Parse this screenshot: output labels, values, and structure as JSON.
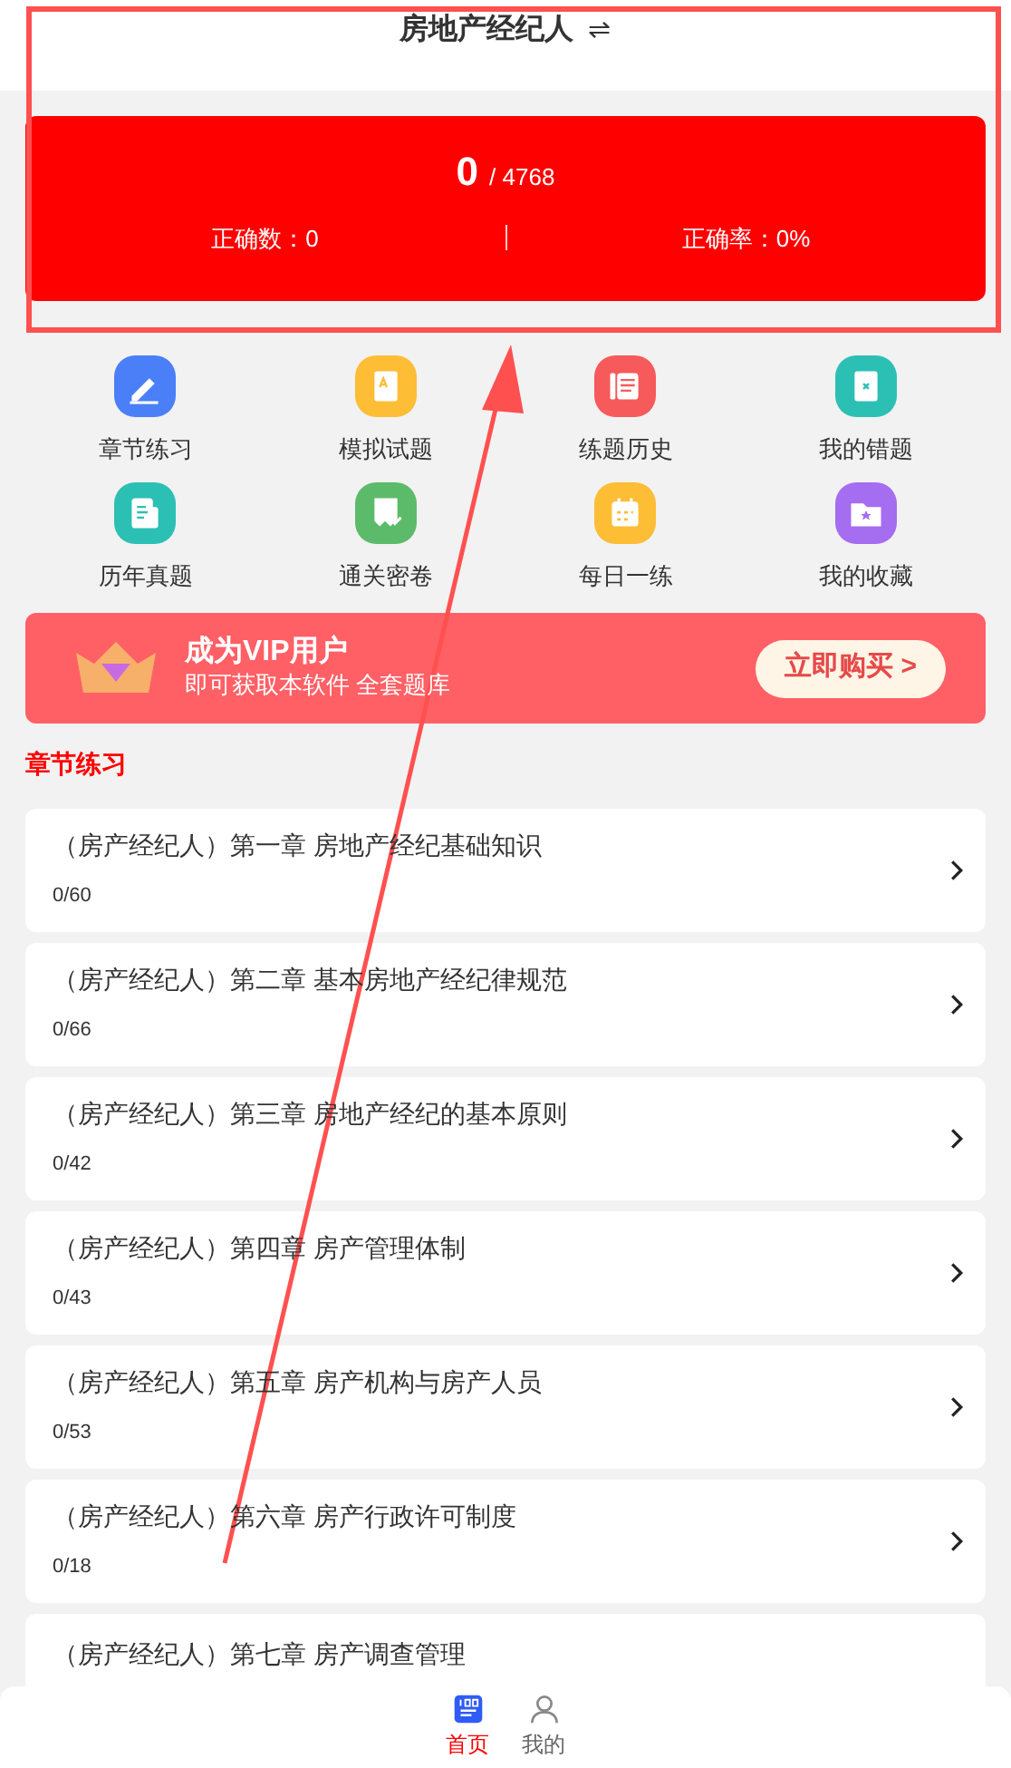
{
  "header": {
    "title": "房地产经纪人",
    "switch_icon": "⇌"
  },
  "summary": {
    "done": "0",
    "total": "/ 4768",
    "correct_count": "正确数：0",
    "correct_rate": "正确率：0%"
  },
  "shortcuts": [
    {
      "label": "章节练习",
      "kind": "pencil",
      "color": "#4a7ff7"
    },
    {
      "label": "模拟试题",
      "kind": "scroll",
      "color": "#fdbd35"
    },
    {
      "label": "练题历史",
      "kind": "notes",
      "color": "#f75a5a"
    },
    {
      "label": "我的错题",
      "kind": "notebook",
      "color": "#2cc0b4"
    },
    {
      "label": "历年真题",
      "kind": "doc",
      "color": "#2cc0b4"
    },
    {
      "label": "通关密卷",
      "kind": "paper",
      "color": "#5cbb6a"
    },
    {
      "label": "每日一练",
      "kind": "calendar",
      "color": "#fdbd35"
    },
    {
      "label": "我的收藏",
      "kind": "folder",
      "color": "#a56df0"
    }
  ],
  "vip_banner": {
    "title": "成为VIP用户",
    "subtitle": "即可获取本软件 全套题库",
    "button": "立即购买 >"
  },
  "section_title": "章节练习",
  "chapters": [
    {
      "title": "（房产经纪人）第一章 房地产经纪基础知识",
      "progress": "0/60"
    },
    {
      "title": "（房产经纪人）第二章 基本房地产经纪律规范",
      "progress": "0/66"
    },
    {
      "title": "（房产经纪人）第三章 房地产经纪的基本原则",
      "progress": "0/42"
    },
    {
      "title": "（房产经纪人）第四章 房产管理体制",
      "progress": "0/43"
    },
    {
      "title": "（房产经纪人）第五章 房产机构与房产人员",
      "progress": "0/53"
    },
    {
      "title": "（房产经纪人）第六章 房产行政许可制度",
      "progress": "0/18"
    },
    {
      "title": "（房产经纪人）第七章 房产调查管理"
    }
  ],
  "tab_bar": [
    {
      "label": "首页",
      "kind": "home",
      "selected": true
    },
    {
      "label": "我的",
      "kind": "user",
      "selected": false
    }
  ]
}
